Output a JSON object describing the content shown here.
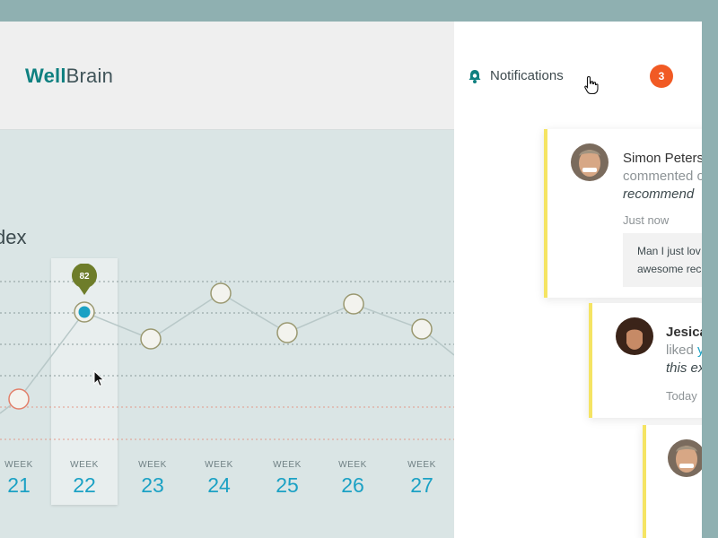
{
  "app": {
    "logo_bold": "Well",
    "logo_light": "Brain",
    "section_title_fragment": "dex"
  },
  "chart_data": {
    "type": "line",
    "x_label_prefix": "WEEK",
    "categories": [
      "21",
      "22",
      "23",
      "24",
      "25",
      "26",
      "27"
    ],
    "series": [
      {
        "values": [
          null,
          82,
          null,
          null,
          null,
          null,
          null
        ],
        "selected_index": 1
      }
    ],
    "selected_value_label": "82",
    "highlighted_week": "22",
    "colors": {
      "line": "#b8c8c8",
      "selected_point": "#1ba1c4",
      "pin": "#6e7d2a",
      "low_point_border": "#e3806a",
      "point_border": "#9a9870",
      "grid_dark": "#8a9a9a",
      "grid_red": "#e39a8a",
      "week_number": "#1ba1c4"
    }
  },
  "notifications": {
    "title": "Notifications",
    "count": "3",
    "items": [
      {
        "name": "Simon Peters",
        "action": "commented o",
        "quote": "recommend",
        "time": "Just now",
        "comment_line1": "Man I just lov",
        "comment_line2": "awesome rec"
      },
      {
        "name": "Jesica",
        "action_prefix": "liked ",
        "action_link": "y",
        "quote": "this ex",
        "time": "Today"
      },
      {
        "name": ""
      }
    ]
  },
  "icons": {
    "bell": "bell-icon",
    "hand_cursor": "hand-pointer-icon",
    "arrow_cursor": "arrow-cursor-icon",
    "map_pin": "map-pin-icon"
  }
}
